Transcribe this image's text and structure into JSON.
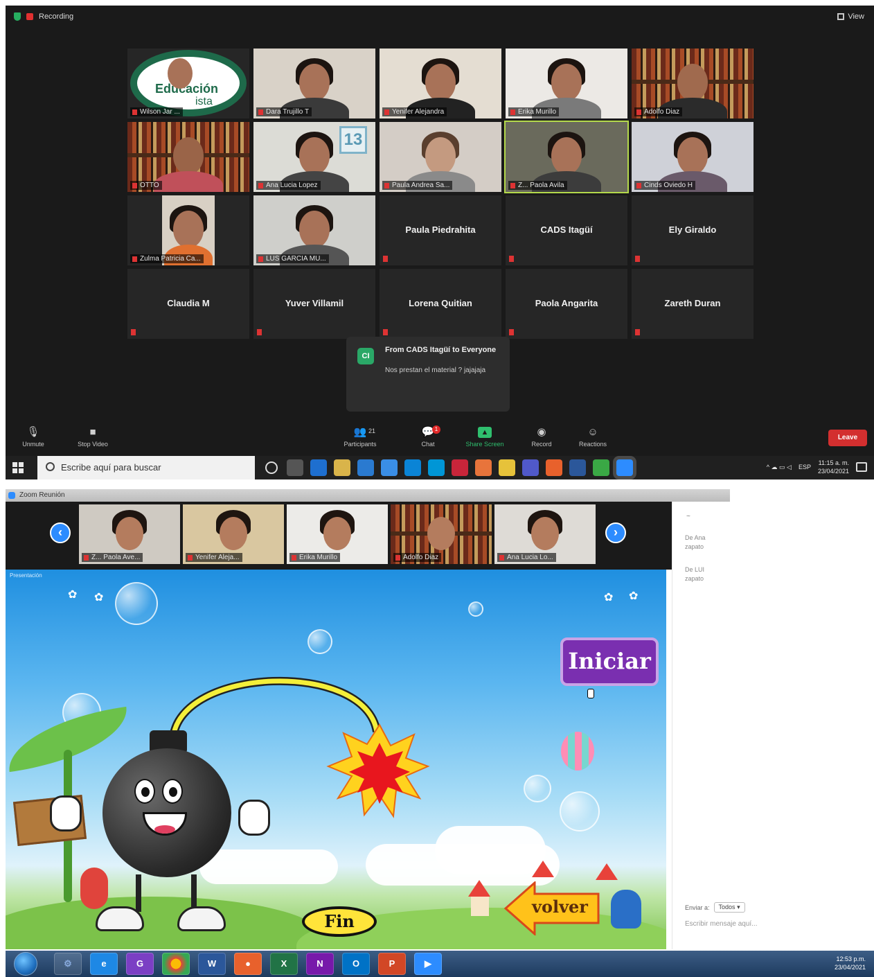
{
  "top": {
    "recording_label": "Recording",
    "view_label": "View",
    "participants": [
      {
        "name": "Wilson Jar ...",
        "kind": "logo"
      },
      {
        "name": "Dara Trujillo T",
        "kind": "video"
      },
      {
        "name": "Yenifer Alejandra",
        "kind": "video"
      },
      {
        "name": "Erika Murillo",
        "kind": "video"
      },
      {
        "name": "Adolfo Diaz",
        "kind": "shelf"
      },
      {
        "name": "OTTO",
        "kind": "shelf"
      },
      {
        "name": "Ana Lucia Lopez",
        "kind": "video"
      },
      {
        "name": "Paula Andrea Sa...",
        "kind": "video"
      },
      {
        "name": "Z... Paola Avila",
        "kind": "video"
      },
      {
        "name": "Cinds Oviedo H",
        "kind": "video"
      },
      {
        "name": "Zulma Patricia Ca...",
        "kind": "video"
      },
      {
        "name": "LUS GARCIA MU...",
        "kind": "video"
      },
      {
        "name": "Paula Piedrahita",
        "kind": "name"
      },
      {
        "name": "CADS Itagüí",
        "kind": "name"
      },
      {
        "name": "Ely Giraldo",
        "kind": "name"
      },
      {
        "name": "Claudia M",
        "kind": "name"
      },
      {
        "name": "Yuver Villamil",
        "kind": "name"
      },
      {
        "name": "Lorena Quitian",
        "kind": "name"
      },
      {
        "name": "Paola Angarita",
        "kind": "name"
      },
      {
        "name": "Zareth Duran",
        "kind": "name"
      }
    ],
    "logo_text_1": "Educación",
    "logo_text_2": "ista",
    "badge_number": "13",
    "chat_popup": {
      "avatar": "CI",
      "from": "From CADS Itagüí to Everyone",
      "message": "Nos prestan el material ? jajajaja"
    },
    "toolbar": {
      "unmute": "Unmute",
      "stop_video": "Stop Video",
      "participants": "Participants",
      "participants_count": "21",
      "chat": "Chat",
      "chat_badge": "1",
      "share_screen": "Share Screen",
      "record": "Record",
      "reactions": "Reactions",
      "leave": "Leave"
    }
  },
  "taskbar1": {
    "search_placeholder": "Escribe aquí para buscar",
    "lang": "ESP",
    "time": "11:15 a. m.",
    "date": "23/04/2021"
  },
  "bottom": {
    "window_title": "Zoom Reunión",
    "slide_tag": "Presentación",
    "thumbs": [
      "Z... Paola Ave...",
      "Yenifer Aleja...",
      "Erika Murillo",
      "Adolfo Diaz",
      "Ana Lucia Lo..."
    ],
    "buttons": {
      "iniciar": "Iniciar",
      "fin": "Fin",
      "volver": "volver"
    },
    "chat_panel": {
      "dash": "~",
      "items": [
        {
          "from": "De Ana",
          "text": "zapato"
        },
        {
          "from": "De LUI",
          "text": "zapato"
        }
      ],
      "send_to": "Enviar a:",
      "send_to_value": "Todos",
      "input_placeholder": "Escribir mensaje aquí..."
    }
  },
  "taskbar2": {
    "apps": [
      "e",
      "G",
      "W",
      "X",
      "N",
      "O",
      "P"
    ],
    "time": "12:53 p.m.",
    "date": "23/04/2021"
  }
}
